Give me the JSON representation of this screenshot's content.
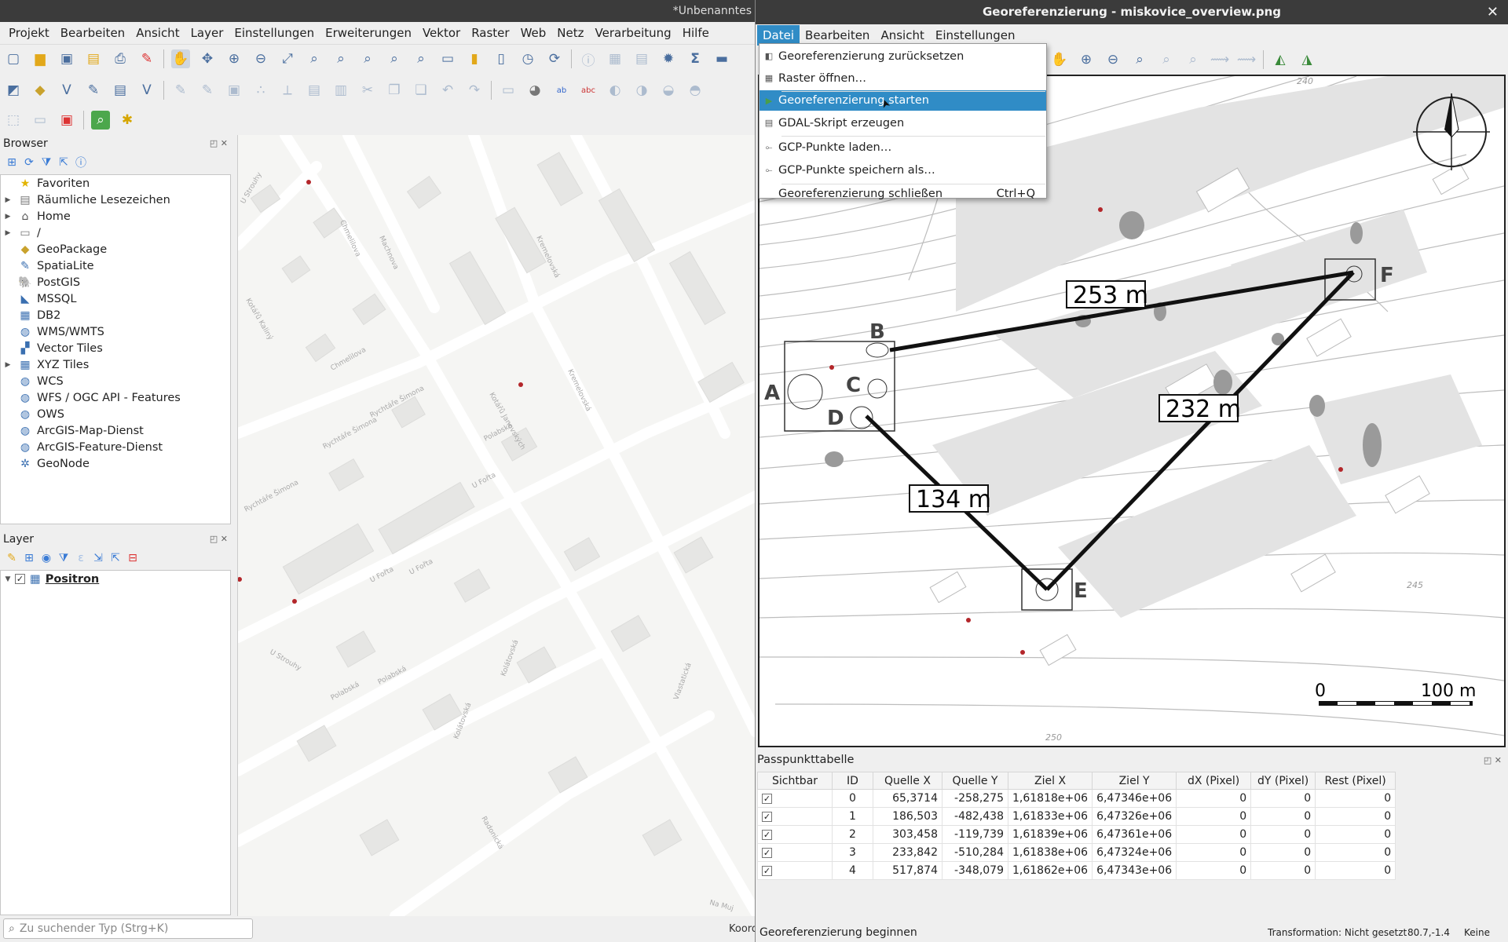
{
  "main_window": {
    "title": "*Unbenanntes",
    "menu": [
      "Projekt",
      "Bearbeiten",
      "Ansicht",
      "Layer",
      "Einstellungen",
      "Erweiterungen",
      "Vektor",
      "Raster",
      "Web",
      "Netz",
      "Verarbeitung",
      "Hilfe"
    ]
  },
  "browser": {
    "title": "Browser",
    "items": [
      {
        "label": "Favoriten",
        "icon": "star-icon",
        "expandable": false
      },
      {
        "label": "Räumliche Lesezeichen",
        "icon": "bookmark-icon",
        "expandable": true
      },
      {
        "label": "Home",
        "icon": "home-folder-icon",
        "expandable": true
      },
      {
        "label": "/",
        "icon": "folder-icon",
        "expandable": true
      },
      {
        "label": "GeoPackage",
        "icon": "geopackage-icon",
        "expandable": false
      },
      {
        "label": "SpatiaLite",
        "icon": "spatialite-icon",
        "expandable": false
      },
      {
        "label": "PostGIS",
        "icon": "postgis-icon",
        "expandable": false
      },
      {
        "label": "MSSQL",
        "icon": "mssql-icon",
        "expandable": false
      },
      {
        "label": "DB2",
        "icon": "db2-icon",
        "expandable": false
      },
      {
        "label": "WMS/WMTS",
        "icon": "globe-icon",
        "expandable": false
      },
      {
        "label": "Vector Tiles",
        "icon": "vector-tiles-icon",
        "expandable": false
      },
      {
        "label": "XYZ Tiles",
        "icon": "xyz-tiles-icon",
        "expandable": true
      },
      {
        "label": "WCS",
        "icon": "globe-icon",
        "expandable": false
      },
      {
        "label": "WFS / OGC API - Features",
        "icon": "globe-icon",
        "expandable": false
      },
      {
        "label": "OWS",
        "icon": "globe-icon",
        "expandable": false
      },
      {
        "label": "ArcGIS-Map-Dienst",
        "icon": "globe-icon",
        "expandable": false
      },
      {
        "label": "ArcGIS-Feature-Dienst",
        "icon": "globe-icon",
        "expandable": false
      },
      {
        "label": "GeoNode",
        "icon": "geonode-icon",
        "expandable": false
      }
    ]
  },
  "layers": {
    "title": "Layer",
    "items": [
      {
        "label": "Positron",
        "checked": true
      }
    ]
  },
  "search": {
    "placeholder": "Zu suchender Typ (Strg+K)"
  },
  "status_main": {
    "coord_label": "Koord"
  },
  "map_labels": [
    "U Strouhy",
    "Chmelilova",
    "Kotářů Kaliný",
    "Chmelilova",
    "Machnova",
    "Rychtáře Šimona",
    "Rychtáře Šimona",
    "Rychtáře Šimona",
    "Kotářů Janovských",
    "Polabská",
    "U Fořta",
    "U Fořta",
    "U Fořta",
    "Polabská",
    "Polabská",
    "Kremelovská",
    "Kremelovská",
    "Kolátovská",
    "Kolátovská",
    "Vlastatická",
    "Radonická",
    "U Strouhy",
    "Na Muj"
  ],
  "georef": {
    "title": "Georeferenzierung - miskovice_overview.png",
    "menu": [
      "Datei",
      "Bearbeiten",
      "Ansicht",
      "Einstellungen"
    ],
    "dropdown": [
      {
        "label": "Georeferenzierung zurücksetzen",
        "shortcut": "",
        "icon": "reset-icon"
      },
      {
        "label": "Raster öffnen…",
        "shortcut": "",
        "icon": "open-raster-icon"
      },
      {
        "label": "Georeferenzierung starten",
        "shortcut": "",
        "icon": "play-icon"
      },
      {
        "label": "GDAL-Skript erzeugen",
        "shortcut": "",
        "icon": "gdal-script-icon"
      },
      {
        "label": "GCP-Punkte laden…",
        "shortcut": "",
        "icon": "load-gcp-icon"
      },
      {
        "label": "GCP-Punkte speichern als…",
        "shortcut": "",
        "icon": "save-gcp-icon"
      },
      {
        "label": "Georeferenzierung schließen",
        "shortcut": "Ctrl+Q",
        "icon": ""
      }
    ],
    "raster": {
      "distances": [
        "253 m",
        "232 m",
        "134 m"
      ],
      "points": [
        "A",
        "B",
        "C",
        "D",
        "E",
        "F"
      ],
      "scale_start": "0",
      "scale_end": "100 m",
      "contours": [
        "240",
        "245",
        "250"
      ]
    },
    "gcp": {
      "title": "Passpunkttabelle",
      "columns": [
        "Sichtbar",
        "ID",
        "Quelle X",
        "Quelle Y",
        "Ziel X",
        "Ziel Y",
        "dX (Pixel)",
        "dY (Pixel)",
        "Rest (Pixel)"
      ],
      "rows": [
        {
          "visible": true,
          "id": "0",
          "qx": "65,3714",
          "qy": "-258,275",
          "zx": "1,61818e+06",
          "zy": "6,47346e+06",
          "dx": "0",
          "dy": "0",
          "rest": "0"
        },
        {
          "visible": true,
          "id": "1",
          "qx": "186,503",
          "qy": "-482,438",
          "zx": "1,61833e+06",
          "zy": "6,47326e+06",
          "dx": "0",
          "dy": "0",
          "rest": "0"
        },
        {
          "visible": true,
          "id": "2",
          "qx": "303,458",
          "qy": "-119,739",
          "zx": "1,61839e+06",
          "zy": "6,47361e+06",
          "dx": "0",
          "dy": "0",
          "rest": "0"
        },
        {
          "visible": true,
          "id": "3",
          "qx": "233,842",
          "qy": "-510,284",
          "zx": "1,61838e+06",
          "zy": "6,47324e+06",
          "dx": "0",
          "dy": "0",
          "rest": "0"
        },
        {
          "visible": true,
          "id": "4",
          "qx": "517,874",
          "qy": "-348,079",
          "zx": "1,61862e+06",
          "zy": "6,47343e+06",
          "dx": "0",
          "dy": "0",
          "rest": "0"
        }
      ]
    },
    "status": {
      "message": "Georeferenzierung beginnen",
      "transformation": "Transformation: Nicht gesetzt",
      "coords": "80.7,-1.4",
      "crs": "Keine"
    }
  },
  "colors": {
    "accent": "#308cc6",
    "titlebar": "#3b3b3b",
    "gcp_point": "#b3262a"
  }
}
